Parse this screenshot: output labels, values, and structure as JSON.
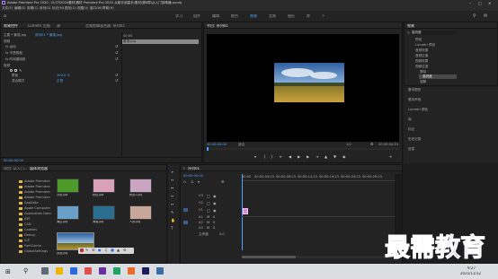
{
  "window": {
    "title": "Adobe Premiere Pro 2020 - D:\\TS2020素材\\素材 Premiere Pro 2020 从新手到高手\\素材\\第8章\\从入门到精通.prproj"
  },
  "menu": [
    "文件(F)",
    "编辑(E)",
    "剪辑(C)",
    "序列(S)",
    "标记(M)",
    "图形(G)",
    "视图(V)",
    "窗口(W)",
    "帮助(H)"
  ],
  "workspace_tabs": {
    "items": [
      "学习",
      "组件",
      "编辑",
      "颜色",
      "效果",
      "音频",
      "图形",
      "库"
    ],
    "active": "效果"
  },
  "effect_controls": {
    "tabs": [
      "效果控件",
      "Lumetri 范围",
      "源",
      "音频剪辑混合器: 序列01"
    ],
    "source_label": "主要 * 景观.jpg",
    "clip_label": "序列01 * 景观.jpg",
    "section_video": "视频",
    "rows": [
      "fx 运动",
      "fx 不透明度",
      "fx 时间重映射",
      "音频"
    ],
    "sub_rows": [
      {
        "label": "蒙版",
        "value": ""
      },
      {
        "label": "蒙版",
        "value": "100.0 %"
      },
      {
        "label": "混合模式",
        "value": "正常"
      }
    ],
    "timecode": "00:00:00:00"
  },
  "mini_timeline": {
    "time": "00:00",
    "clip_label": "景观.jpg"
  },
  "program_monitor": {
    "tab": "节目: 序列01",
    "timecode_left": "00:00:00:00",
    "fit_label": "适合",
    "scale_label": "1/2",
    "timecode_right": "00:00:04:23"
  },
  "effects_panel": {
    "title": "效果",
    "search_value": "高亮度",
    "tree": [
      "预设",
      "Lumetri 预设",
      "音频效果",
      "音频过渡",
      "视频效果",
      "视频过渡",
      "擦除",
      "高亮度",
      "溶解"
    ],
    "sections": [
      "基本图形",
      "基本声音",
      "Lumetri 颜色",
      "库",
      "标记",
      "历史记录",
      "信息"
    ]
  },
  "project_panel": {
    "tabs": [
      "项目: 从入门...",
      "媒体浏览器"
    ],
    "folders": [
      "Adobe Premiere Pro",
      "Adobe Premiere Pro",
      "Adobe Premiere Pro",
      "Adobe Premiere Pro",
      "AppData",
      "Apple Computer",
      "Application Data",
      "ATE",
      "C4D",
      "Cookies",
      "Debug",
      "ICE",
      "FontCache",
      "GlobalSettings"
    ],
    "thumbs": [
      {
        "label": "背景.jpg",
        "color": "#4c9a2a"
      },
      {
        "label": "粉色.jpg",
        "color": "#d8a1b8"
      },
      {
        "label": "粉色2.jpg",
        "color": "#c9a5c2"
      },
      {
        "label": "海边.jpg",
        "color": "#6aa0c8"
      },
      {
        "label": "海滩.jpg",
        "color": "#2b6d8e"
      },
      {
        "label": "人物.jpg",
        "color": "#c8a79a"
      }
    ],
    "hover_thumb_label": "景观.jpg"
  },
  "timeline": {
    "tab": "序列01",
    "timecode": "00:00:00:00",
    "ruler": [
      "00:00",
      "00:00:04:23",
      "00:00:09:23",
      "00:00:14:23",
      "00:00:19:23",
      "00:00:24:23",
      "00:00:29:23"
    ],
    "tracks": [
      "V3",
      "V2",
      "V1",
      "A1",
      "A2",
      "A3"
    ],
    "master": "主声道",
    "master_value": "0.0"
  },
  "taskbar": {
    "time": "9:27",
    "date": "2021/11/12"
  },
  "watermark": "最需教育",
  "colors": {
    "accent": "#4fa3ff",
    "background": "#1d1d1d",
    "panel": "#232323",
    "clip": "#d98bd8"
  }
}
